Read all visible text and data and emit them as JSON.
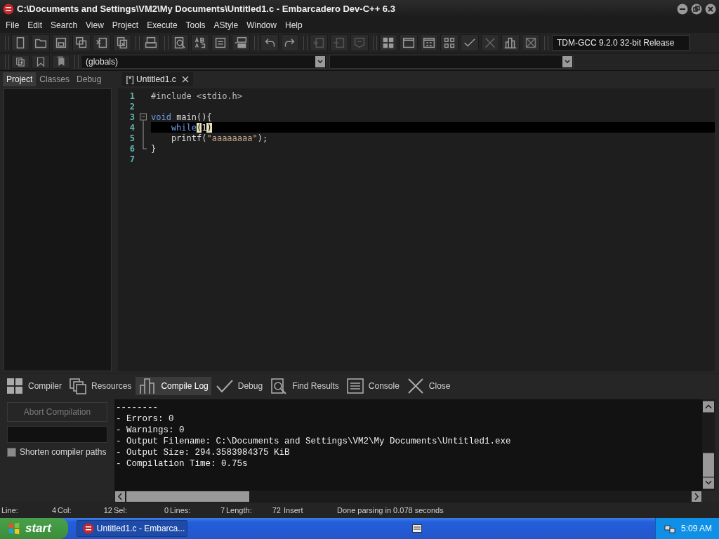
{
  "window": {
    "title": "C:\\Documents and Settings\\VM2\\My Documents\\Untitled1.c - Embarcadero Dev-C++ 6.3"
  },
  "menu": [
    "File",
    "Edit",
    "Search",
    "View",
    "Project",
    "Execute",
    "Tools",
    "AStyle",
    "Window",
    "Help"
  ],
  "toolbar": {
    "compiler": "TDM-GCC 9.2.0 32-bit Release",
    "scope": "(globals)"
  },
  "side_tabs": [
    {
      "label": "Project",
      "selected": true
    },
    {
      "label": "Classes",
      "selected": false
    },
    {
      "label": "Debug",
      "selected": false
    }
  ],
  "editor_tabs": [
    {
      "label": "[*] Untitled1.c",
      "selected": true
    }
  ],
  "editor": {
    "lines": [
      {
        "number": "1",
        "kind": "plain",
        "current": false,
        "tokens": [
          {
            "text": "#include <stdio.h>",
            "kind": "preprocessor"
          }
        ]
      },
      {
        "number": "2",
        "kind": "plain",
        "current": false
      },
      {
        "number": "3",
        "kind": "fold-start",
        "current": false,
        "tokens": [
          {
            "text": "void",
            "kind": "keyword"
          },
          {
            "text": " main(){",
            "kind": "plain"
          }
        ]
      },
      {
        "number": "4",
        "kind": "fold-body",
        "current": true,
        "tokens": [
          {
            "text": "while",
            "kind": "keyword"
          },
          {
            "text": "(",
            "kind": "match"
          },
          {
            "text": "1",
            "kind": "number"
          },
          {
            "text": ")",
            "kind": "match"
          }
        ]
      },
      {
        "number": "5",
        "kind": "fold-body",
        "current": false,
        "tokens": [
          {
            "text": "printf(",
            "kind": "plain"
          },
          {
            "text": "\"aaaaaaaa\"",
            "kind": "string"
          },
          {
            "text": ");",
            "kind": "plain"
          }
        ]
      },
      {
        "number": "6",
        "kind": "fold-end",
        "current": false,
        "tokens": [
          {
            "text": "}",
            "kind": "plain"
          }
        ]
      },
      {
        "number": "7",
        "kind": "plain",
        "current": false
      }
    ]
  },
  "bottom_tabs": [
    {
      "label": "Compiler",
      "selected": false
    },
    {
      "label": "Resources",
      "selected": false
    },
    {
      "label": "Compile Log",
      "selected": true
    },
    {
      "label": "Debug",
      "selected": false
    },
    {
      "label": "Find Results",
      "selected": false
    },
    {
      "label": "Console",
      "selected": false
    },
    {
      "label": "Close",
      "selected": false
    }
  ],
  "compile_panel": {
    "abort_button": {
      "label": "Abort Compilation",
      "disabled": true
    },
    "progress": {
      "level": 0
    },
    "shorten_paths": {
      "label": "Shorten compiler paths",
      "checked": false
    }
  },
  "compile_log": [
    "--------",
    "- Errors: 0",
    "- Warnings: 0",
    "- Output Filename: C:\\Documents and Settings\\VM2\\My Documents\\Untitled1.exe",
    "- Output Size: 294.3583984375 KiB",
    "- Compilation Time: 0.75s"
  ],
  "status_bar": {
    "fields": [
      {
        "label": "Line:",
        "value": "4"
      },
      {
        "label": "Col:",
        "value": "12"
      },
      {
        "label": "Sel:",
        "value": "0"
      },
      {
        "label": "Lines:",
        "value": "7"
      },
      {
        "label": "Length:",
        "value": "72"
      }
    ],
    "mode": "Insert",
    "message": "Done parsing in 0.078 seconds"
  },
  "taskbar": {
    "start": "start",
    "tasks": [
      {
        "label": "Untitled1.c - Embarca...",
        "selected": true
      }
    ],
    "clock": "5:09 AM"
  }
}
